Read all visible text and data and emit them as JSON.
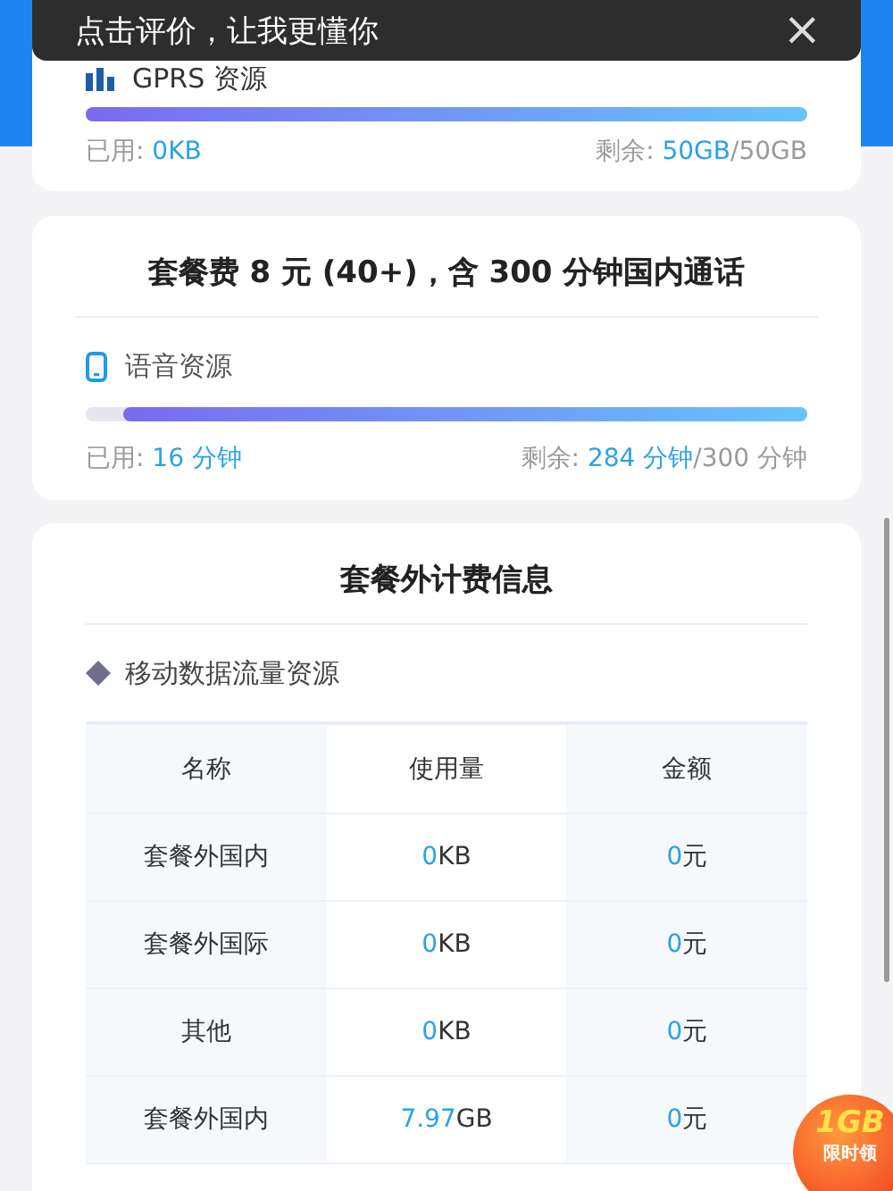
{
  "toast": {
    "text": "点击评价，让我更懂你",
    "close": "×"
  },
  "data_card": {
    "label": "GPRS 资源",
    "level": 1,
    "used_label": "已用: ",
    "used": "0KB",
    "remaining_label": "剩余: ",
    "remaining": "50GB",
    "total": "/50GB"
  },
  "plan_card": {
    "title": "套餐费 8 元 (40+)，含 300 分钟国内通话",
    "label": "语音资源",
    "level": 0.947,
    "used_label": "已用: ",
    "used": "16 分钟",
    "remaining_label": "剩余: ",
    "remaining": "284 分钟",
    "total": "/300 分钟"
  },
  "extra_card": {
    "title": "套餐外计费信息",
    "section": "移动数据流量资源",
    "table": {
      "columns": [
        "名称",
        "使用量",
        "金额"
      ],
      "rows": [
        {
          "name": "套餐外国内",
          "usage": "0",
          "usage_unit": "KB",
          "amount": "0",
          "amount_unit": "元"
        },
        {
          "name": "套餐外国际",
          "usage": "0",
          "usage_unit": "KB",
          "amount": "0",
          "amount_unit": "元"
        },
        {
          "name": "其他",
          "usage": "0",
          "usage_unit": "KB",
          "amount": "0",
          "amount_unit": "元"
        },
        {
          "name": "套餐外国内",
          "usage": "7.97",
          "usage_unit": "GB",
          "amount": "0",
          "amount_unit": "元"
        }
      ]
    }
  },
  "promo_badge": {
    "top": "1GB",
    "bottom": "限时领"
  }
}
